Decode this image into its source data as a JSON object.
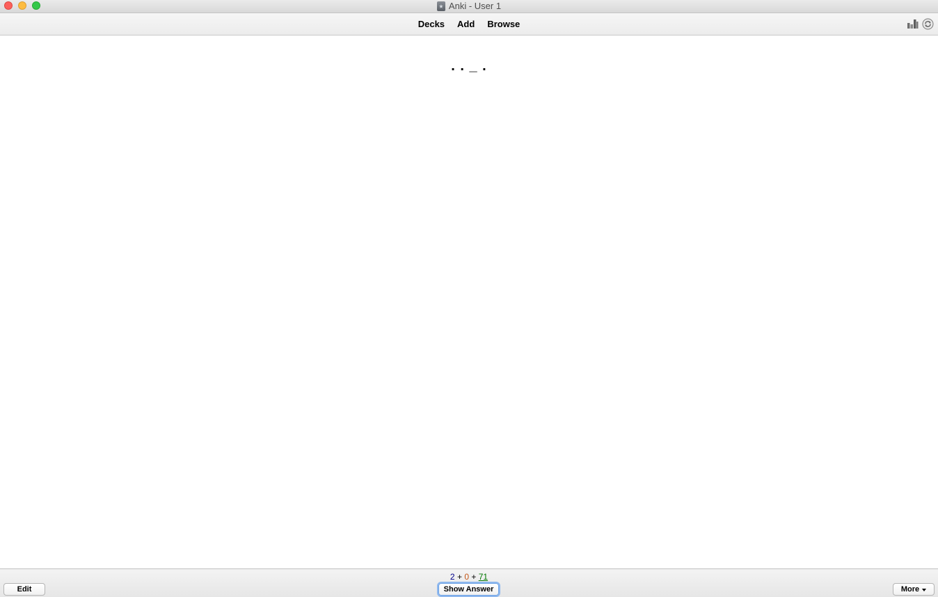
{
  "window": {
    "title": "Anki - User 1"
  },
  "toolbar": {
    "nav": [
      {
        "label": "Decks"
      },
      {
        "label": "Add"
      },
      {
        "label": "Browse"
      }
    ],
    "icons": [
      "stats-icon",
      "sync-icon"
    ]
  },
  "card": {
    "question": ". . _ ."
  },
  "bottom": {
    "edit_label": "Edit",
    "show_answer_label": "Show Answer",
    "more_label": "More",
    "counts": {
      "new": "2",
      "learning": "0",
      "review": "71",
      "sep": "+"
    }
  },
  "colors": {
    "new": "#00008b",
    "learning": "#c35617",
    "review": "#007700",
    "focus_ring": "#8fb8ee"
  }
}
